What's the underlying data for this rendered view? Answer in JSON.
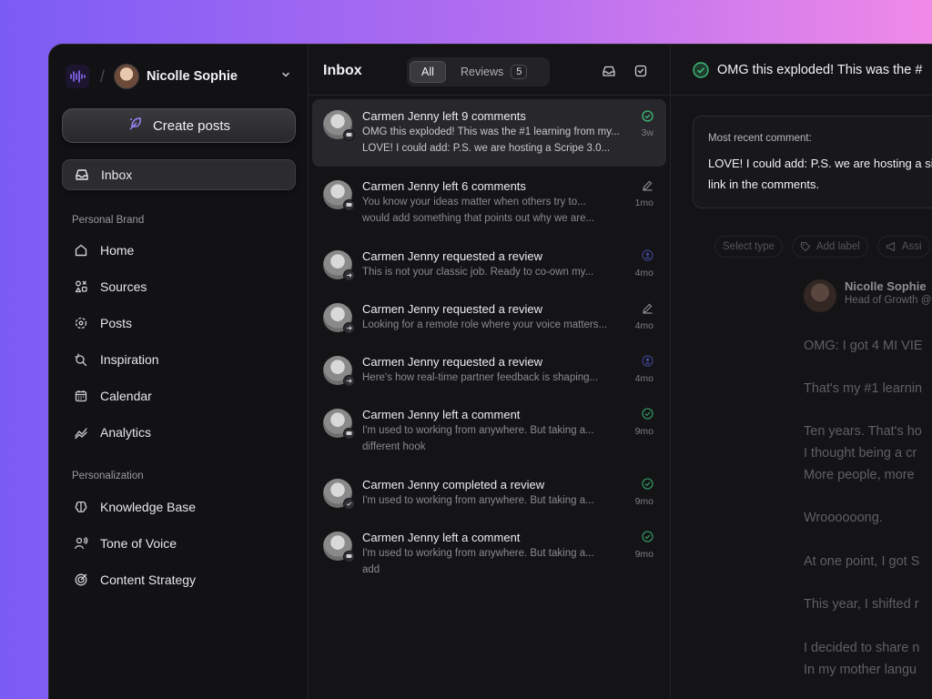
{
  "workspace": {
    "name": "Nicolle Sophie"
  },
  "sidebar": {
    "create_label": "Create posts",
    "inbox_label": "Inbox",
    "section1": "Personal Brand",
    "items1": [
      {
        "label": "Home",
        "icon": "home-icon"
      },
      {
        "label": "Sources",
        "icon": "sources-icon"
      },
      {
        "label": "Posts",
        "icon": "posts-icon"
      },
      {
        "label": "Inspiration",
        "icon": "inspiration-icon"
      },
      {
        "label": "Calendar",
        "icon": "calendar-icon"
      },
      {
        "label": "Analytics",
        "icon": "analytics-icon"
      }
    ],
    "section2": "Personalization",
    "items2": [
      {
        "label": "Knowledge Base",
        "icon": "brain-icon"
      },
      {
        "label": "Tone of Voice",
        "icon": "voice-icon"
      },
      {
        "label": "Content Strategy",
        "icon": "target-icon"
      }
    ]
  },
  "inbox": {
    "title": "Inbox",
    "tab_all": "All",
    "tab_reviews": "Reviews",
    "reviews_count": "5",
    "messages": [
      {
        "title": "Carmen Jenny left 9 comments",
        "line1": "OMG this exploded! This was the #1 learning from my...",
        "line2": "LOVE! I could add: P.S. we are hosting a Scripe 3.0...",
        "time": "3w",
        "status": "check"
      },
      {
        "title": "Carmen Jenny left 6 comments",
        "line1": "You know your ideas matter when others try to...",
        "line2": "would add something that points out why we are...",
        "time": "1mo",
        "status": "pen"
      },
      {
        "title": "Carmen Jenny requested a review",
        "line1": "This is not your classic job. Ready to co-own my...",
        "line2": "",
        "time": "4mo",
        "status": "user"
      },
      {
        "title": "Carmen Jenny requested a review",
        "line1": "Looking for a remote role where your voice matters...",
        "line2": "",
        "time": "4mo",
        "status": "pen"
      },
      {
        "title": "Carmen Jenny requested a review",
        "line1": "Here's how real-time partner feedback is shaping...",
        "line2": "",
        "time": "4mo",
        "status": "user"
      },
      {
        "title": "Carmen Jenny left a comment",
        "line1": "I'm used to working from anywhere. But taking a...",
        "line2": "different hook",
        "time": "9mo",
        "status": "check"
      },
      {
        "title": "Carmen Jenny completed a review",
        "line1": "I'm used to working from anywhere. But taking a...",
        "line2": "",
        "time": "9mo",
        "status": "check"
      },
      {
        "title": "Carmen Jenny left a comment",
        "line1": "I'm used to working from anywhere. But taking a...",
        "line2": "add",
        "time": "9mo",
        "status": "check"
      }
    ]
  },
  "detail": {
    "title": "OMG this exploded! This was the #",
    "recent_label": "Most recent comment:",
    "recent_text": "LOVE! I could add: P.S. we are hosting a sign-up link in the comments.",
    "chips": [
      "Select type",
      "Add label",
      "Assi"
    ],
    "author": "Nicolle Sophie",
    "role": "Head of Growth @",
    "paragraphs": [
      "OMG: I got 4 MI VIE",
      "That's my #1 learnin",
      "Ten years. That's ho",
      "I thought being a cr",
      "More people, more",
      "Wroooooong.",
      "At one point, I got S",
      "This year, I shifted r",
      "I decided to share n",
      "In my mother langu"
    ]
  },
  "colors": {
    "accent_green": "#3fb97a",
    "accent_purple": "#7c5cf5"
  }
}
